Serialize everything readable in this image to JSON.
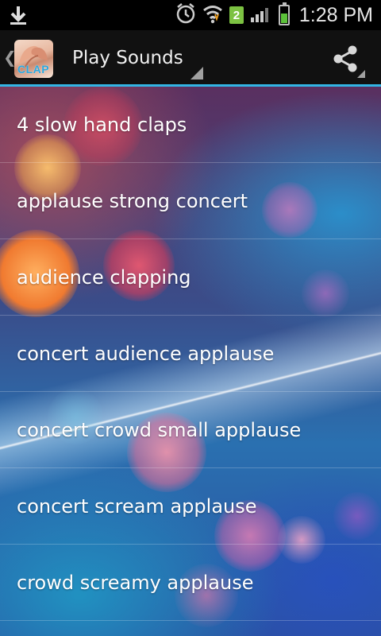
{
  "status_bar": {
    "time": "1:28 PM",
    "sim_slot": "2",
    "icons": [
      "download-icon",
      "alarm-icon",
      "wifi-icon",
      "signal-icon",
      "battery-icon"
    ],
    "battery_level": 0.55,
    "battery_color": "#5cc13a"
  },
  "action_bar": {
    "title": "Play Sounds",
    "app_icon_text": "CLAP",
    "accent_color": "#33b5e5",
    "share_icon": "share-icon"
  },
  "sounds": [
    "4 slow hand claps",
    "applause strong concert",
    "audience clapping",
    "concert audience applause",
    "concert crowd small applause",
    "concert scream applause",
    "crowd screamy applause"
  ]
}
